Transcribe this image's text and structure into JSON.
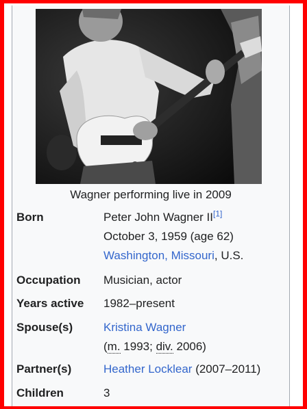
{
  "caption": "Wagner performing live in 2009",
  "photo_icon": "guitarist-photo",
  "rows": {
    "born": {
      "label": "Born",
      "name": "Peter John Wagner II",
      "ref": "[1]",
      "date": "October 3, 1959 (age 62)",
      "place_link": "Washington, Missouri",
      "place_rest": ", U.S."
    },
    "occupation": {
      "label": "Occupation",
      "value": "Musician, actor"
    },
    "years_active": {
      "label": "Years active",
      "value": "1982–present"
    },
    "spouse": {
      "label": "Spouse(s)",
      "link": "Kristina Wagner",
      "open": "(",
      "married_abbr": "m.",
      "married_year": " 1993; ",
      "divorced_abbr": "div.",
      "divorced_year": " 2006)"
    },
    "partner": {
      "label": "Partner(s)",
      "link": "Heather Locklear",
      "rest": " (2007–2011)"
    },
    "children": {
      "label": "Children",
      "value": "3"
    }
  },
  "colors": {
    "link": "#3366cc",
    "text": "#202122",
    "frame": "#ff0000",
    "box_bg": "#f8f9fa"
  }
}
